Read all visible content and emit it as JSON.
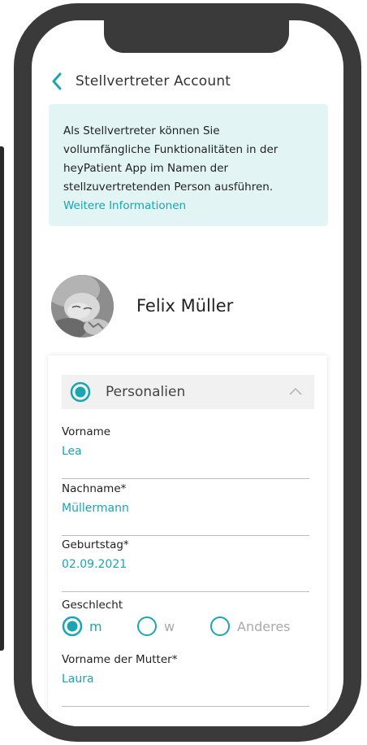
{
  "header": {
    "title": "Stellvertreter Account"
  },
  "info": {
    "lines": [
      "Als Stellvertreter können Sie",
      "vollumfängliche Funktionalitäten in der",
      "heyPatient App im Namen der",
      "stellzuvertretenden Person ausführen."
    ],
    "link": "Weitere Informationen"
  },
  "profile": {
    "name": "Felix Müller"
  },
  "section": {
    "title": "Personalien"
  },
  "fields": [
    {
      "label": "Vorname",
      "value": "Lea"
    },
    {
      "label": "Nachname*",
      "value": "Müllermann"
    },
    {
      "label": "Geburtstag*",
      "value": "02.09.2021"
    }
  ],
  "gender": {
    "label": "Geschlecht",
    "options": [
      {
        "label": "m",
        "selected": true
      },
      {
        "label": "w",
        "selected": false
      },
      {
        "label": "Anderes",
        "selected": false
      }
    ]
  },
  "mother_field": {
    "label": "Vorname der Mutter*",
    "value": "Laura"
  },
  "colors": {
    "accent": "#1aa5b0",
    "info_bg": "#e2f4f4",
    "frame": "#3a3a3a"
  }
}
